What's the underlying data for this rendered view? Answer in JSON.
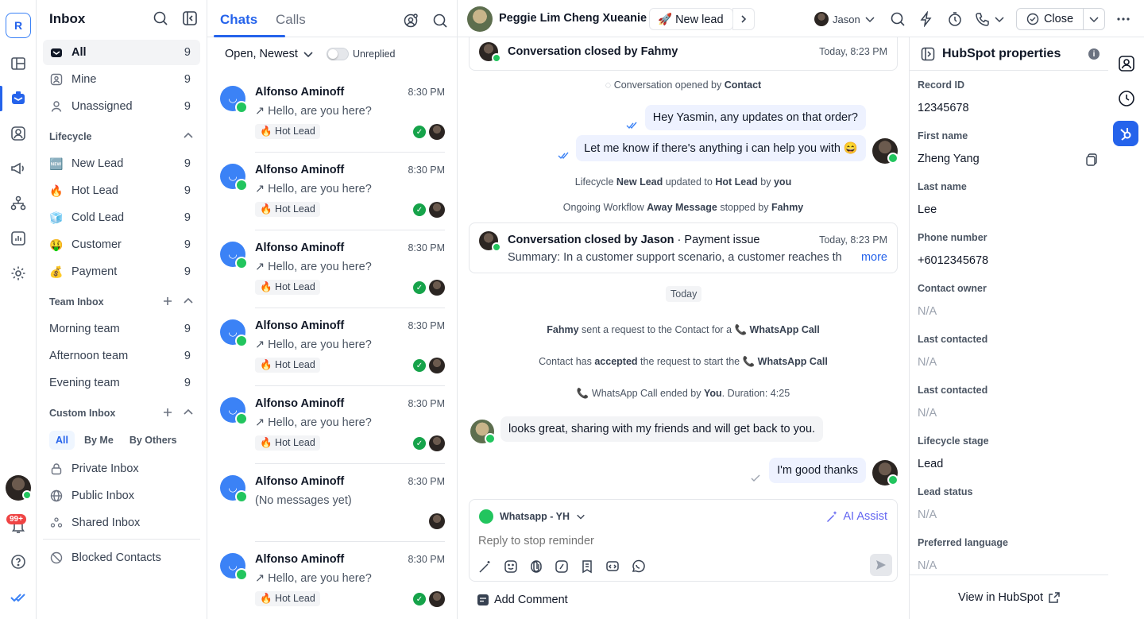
{
  "rail": {
    "logo": "R",
    "notif_badge": "99+"
  },
  "sidebar": {
    "title": "Inbox",
    "main_items": [
      {
        "label": "All",
        "count": "9"
      },
      {
        "label": "Mine",
        "count": "9"
      },
      {
        "label": "Unassigned",
        "count": "9"
      }
    ],
    "lifecycle_title": "Lifecycle",
    "lifecycle_items": [
      {
        "emoji": "🆕",
        "label": "New Lead",
        "count": "9"
      },
      {
        "emoji": "🔥",
        "label": "Hot Lead",
        "count": "9"
      },
      {
        "emoji": "🧊",
        "label": "Cold Lead",
        "count": "9"
      },
      {
        "emoji": "🤑",
        "label": "Customer",
        "count": "9"
      },
      {
        "emoji": "💰",
        "label": "Payment",
        "count": "9"
      }
    ],
    "team_title": "Team Inbox",
    "team_items": [
      {
        "label": "Morning team",
        "count": "9"
      },
      {
        "label": "Afternoon team",
        "count": "9"
      },
      {
        "label": "Evening team",
        "count": "9"
      }
    ],
    "custom_title": "Custom Inbox",
    "custom_chips": [
      "All",
      "By Me",
      "By Others"
    ],
    "custom_items": [
      {
        "label": "Private Inbox"
      },
      {
        "label": "Public Inbox"
      },
      {
        "label": "Shared Inbox"
      }
    ],
    "blocked": "Blocked Contacts"
  },
  "chat_list": {
    "tabs": [
      "Chats",
      "Calls"
    ],
    "filter": "Open, Newest",
    "toggle_label": "Unreplied",
    "chats": [
      {
        "name": "Alfonso Aminoff",
        "time": "8:30 PM",
        "message": "↗ Hello, are you here?",
        "tag": "🔥 Hot Lead",
        "replied": true
      },
      {
        "name": "Alfonso Aminoff",
        "time": "8:30 PM",
        "message": "↗ Hello, are you here?",
        "tag": "🔥 Hot Lead",
        "replied": true
      },
      {
        "name": "Alfonso Aminoff",
        "time": "8:30 PM",
        "message": "↗ Hello, are you here?",
        "tag": "🔥 Hot Lead",
        "replied": true
      },
      {
        "name": "Alfonso Aminoff",
        "time": "8:30 PM",
        "message": "↗ Hello, are you here?",
        "tag": "🔥 Hot Lead",
        "replied": true
      },
      {
        "name": "Alfonso Aminoff",
        "time": "8:30 PM",
        "message": "↗ Hello, are you here?",
        "tag": "🔥 Hot Lead",
        "replied": true
      },
      {
        "name": "Alfonso Aminoff",
        "time": "8:30 PM",
        "message": "(No messages yet)",
        "tag": "",
        "replied": false
      },
      {
        "name": "Alfonso Aminoff",
        "time": "8:30 PM",
        "message": "↗ Hello, are you here?",
        "tag": "🔥 Hot Lead",
        "replied": true
      }
    ]
  },
  "header": {
    "contact_name": "Peggie Lim Cheng Xueanie",
    "lifecycle_pill": "🚀 New lead",
    "assignee": "Jason",
    "close_label": "Close"
  },
  "conversation": {
    "closed_fahmy": {
      "title": "Conversation closed by Fahmy",
      "time": "Today, 8:23 PM"
    },
    "opened_by": {
      "prefix": "Conversation opened by",
      "who": "Contact"
    },
    "out_msg_1": "Hey Yasmin, any updates on that order?",
    "out_msg_2": "Let me know if there's anything i can help you with 😄",
    "lifecycle_update": {
      "p1": "Lifecycle",
      "b1": "New Lead",
      "p2": "updated to",
      "b2": "Hot Lead",
      "p3": "by",
      "b3": "you"
    },
    "workflow_stop": {
      "p1": "Ongoing Workflow",
      "b1": "Away Message",
      "p2": "stopped by",
      "b2": "Fahmy"
    },
    "closed_jason": {
      "title": "Conversation closed by Jason",
      "subtitle": " · Payment issue",
      "time": "Today, 8:23 PM",
      "summary_label": "Summary:",
      "summary": "In a customer support scenario, a customer reaches th...",
      "more": "more"
    },
    "date_chip": "Today",
    "call_request": {
      "b1": "Fahmy",
      "p1": "sent a request to the Contact for a",
      "b2": "📞 WhatsApp Call"
    },
    "call_accept": {
      "p1": "Contact has",
      "b1": "accepted",
      "p2": "the request to start the",
      "b2": "📞 WhatsApp Call"
    },
    "call_end": {
      "p1": "WhatsApp Call ended by",
      "b1": "You",
      "p2": ". Duration: 4:25"
    },
    "in_msg": "looks great, sharing with my friends and will get back to you.",
    "out_msg_3": "I'm good thanks"
  },
  "composer": {
    "channel": "Whatsapp - YH",
    "ai_assist": "AI Assist",
    "placeholder": "Reply to stop reminder",
    "add_comment": "Add Comment"
  },
  "hubspot": {
    "title": "HubSpot properties",
    "properties": [
      {
        "label": "Record ID",
        "value": "12345678",
        "empty": false
      },
      {
        "label": "First name",
        "value": "Zheng Yang",
        "empty": false
      },
      {
        "label": "Last name",
        "value": "Lee",
        "empty": false
      },
      {
        "label": "Phone number",
        "value": "+6012345678",
        "empty": false
      },
      {
        "label": "Contact owner",
        "value": "N/A",
        "empty": true
      },
      {
        "label": "Last contacted",
        "value": "N/A",
        "empty": true
      },
      {
        "label": "Last contacted",
        "value": "N/A",
        "empty": true
      },
      {
        "label": "Lifecycle stage",
        "value": "Lead",
        "empty": false
      },
      {
        "label": "Lead status",
        "value": "N/A",
        "empty": true
      },
      {
        "label": "Preferred language",
        "value": "N/A",
        "empty": true
      }
    ],
    "footer": "View in HubSpot"
  },
  "colors": {
    "accent": "#2563eb",
    "whatsapp": "#22c55e",
    "hubspot_tab": "#2563eb"
  }
}
